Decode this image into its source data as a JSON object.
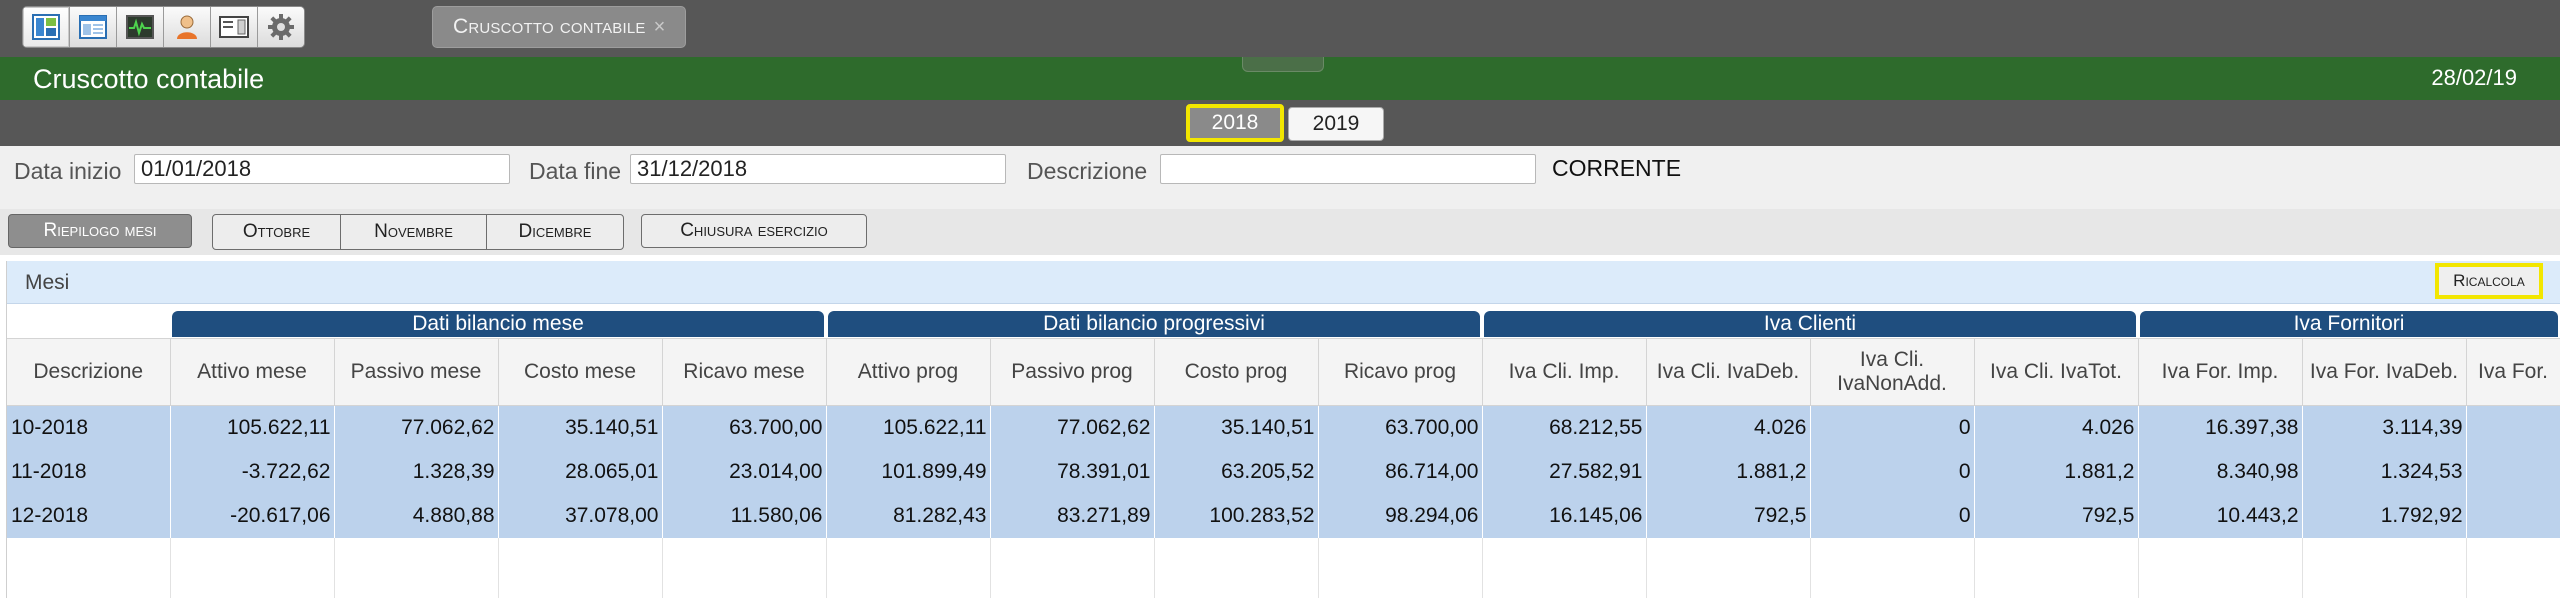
{
  "toolbar": {
    "icons": [
      "dashboard-icon",
      "layout-icon",
      "monitor-icon",
      "user-icon",
      "card-icon",
      "gear-icon"
    ],
    "doc_tab": "Cruscotto contabile",
    "doc_tab_close": "×"
  },
  "header": {
    "title": "Cruscotto contabile",
    "date": "28/02/19"
  },
  "years": [
    "2018",
    "2019"
  ],
  "selected_year": "2018",
  "filters": {
    "data_inizio_label": "Data inizio",
    "data_inizio_value": "01/01/2018",
    "data_fine_label": "Data fine",
    "data_fine_value": "31/12/2018",
    "descrizione_label": "Descrizione",
    "descrizione_value": "",
    "status": "CORRENTE"
  },
  "month_tabs": {
    "riepilogo": "Riepilogo mesi",
    "ottobre": "Ottobre",
    "novembre": "Novembre",
    "dicembre": "Dicembre",
    "chiusura": "Chiusura esercizio"
  },
  "panel": {
    "label": "Mesi",
    "ricalcola": "Ricalcola"
  },
  "table": {
    "groups": [
      "Dati bilancio mese",
      "Dati bilancio progressivi",
      "Iva Clienti",
      "Iva Fornitori"
    ],
    "columns": [
      "Descrizione",
      "Attivo mese",
      "Passivo mese",
      "Costo mese",
      "Ricavo mese",
      "Attivo prog",
      "Passivo prog",
      "Costo prog",
      "Ricavo prog",
      "Iva Cli. Imp.",
      "Iva Cli. IvaDeb.",
      "Iva Cli. IvaNonAdd.",
      "Iva Cli. IvaTot.",
      "Iva For. Imp.",
      "Iva For. IvaDeb.",
      "Iva For."
    ],
    "rows": [
      [
        "10-2018",
        "105.622,11",
        "77.062,62",
        "35.140,51",
        "63.700,00",
        "105.622,11",
        "77.062,62",
        "35.140,51",
        "63.700,00",
        "68.212,55",
        "4.026",
        "0",
        "4.026",
        "16.397,38",
        "3.114,39",
        ""
      ],
      [
        "11-2018",
        "-3.722,62",
        "1.328,39",
        "28.065,01",
        "23.014,00",
        "101.899,49",
        "78.391,01",
        "63.205,52",
        "86.714,00",
        "27.582,91",
        "1.881,2",
        "0",
        "1.881,2",
        "8.340,98",
        "1.324,53",
        ""
      ],
      [
        "12-2018",
        "-20.617,06",
        "4.880,88",
        "37.078,00",
        "11.580,06",
        "81.282,43",
        "83.271,89",
        "100.283,52",
        "98.294,06",
        "16.145,06",
        "792,5",
        "0",
        "792,5",
        "10.443,2",
        "1.792,92",
        ""
      ]
    ]
  }
}
